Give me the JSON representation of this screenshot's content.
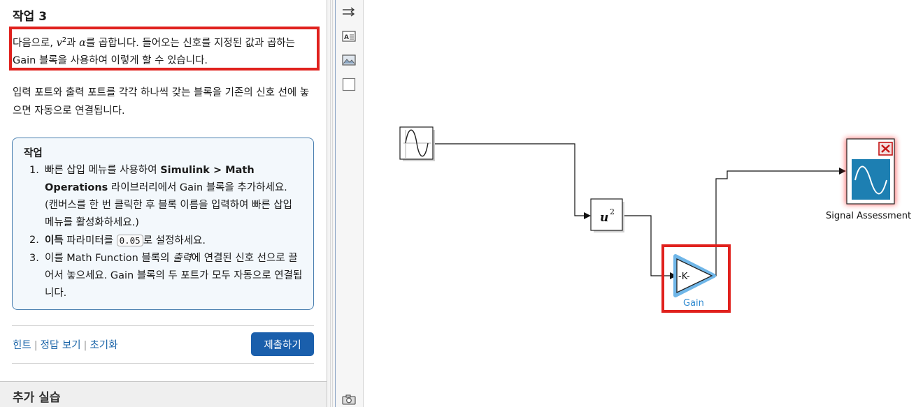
{
  "left_panel": {
    "task_title": "작업 3",
    "intro_part1": "다음으로,",
    "intro_var": "v",
    "intro_exp": "2",
    "intro_part2": "과",
    "intro_alpha": "α",
    "intro_part3": "를 곱합니다. 들어오는 신호를 지정된 값과 곱하는 Gain 블록을 사용하여 이렇게 할 수 있습니다.",
    "para2": "입력 포트와 출력 포트를 각각 하나씩 갖는 블록을 기존의 신호 선에 놓으면 자동으로 연결됩니다.",
    "task_box": {
      "title": "작업",
      "items": [
        {
          "num": "1.",
          "t1": "빠른 삽입 메뉴를 사용하여 ",
          "b1": "Simulink > Math Operations",
          "t2": " 라이브러리에서 Gain 블록을 추가하세요. (캔버스를 한 번 클릭한 후 블록 이름을 입력하여 빠른 삽입 메뉴를 활성화하세요.)"
        },
        {
          "num": "2.",
          "b1": "이득",
          "t1": " 파라미터를 ",
          "code": "0.05",
          "t2": "로 설정하세요."
        },
        {
          "num": "3.",
          "t1": "이를 Math Function 블록의 ",
          "em": "출력",
          "t2": "에 연결된 신호 선으로 끌어서 놓으세요. Gain 블록의 두 포트가 모두 자동으로 연결됩니다."
        }
      ]
    },
    "links": {
      "hint": "힌트",
      "answer": "정답 보기",
      "reset": "초기화",
      "sep": "|"
    },
    "submit_label": "제출하기",
    "more_title": "추가 실습"
  },
  "toolbar": {
    "icons": [
      "arrows-icon",
      "annotation-icon",
      "image-icon",
      "area-icon",
      "camera-icon"
    ]
  },
  "canvas": {
    "blocks": {
      "math_label_base": "u",
      "math_label_exp": "2",
      "gain_text": "-K-",
      "gain_name": "Gain",
      "scope_name": "Signal Assessment"
    },
    "colors": {
      "highlight_red": "#e0211d",
      "gain_blue": "#3a9ad9",
      "scope_teal": "#1a7fb0",
      "submit_blue": "#1a5fac"
    }
  }
}
